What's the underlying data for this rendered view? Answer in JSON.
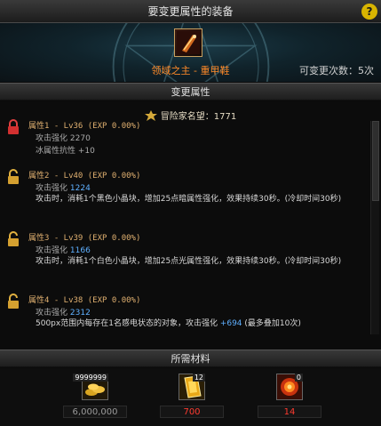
{
  "window": {
    "title": "要变更属性的装备",
    "help_label": "?"
  },
  "equip": {
    "item_name": "领域之主 - 重甲鞋",
    "change_count": "可变更次数：5次",
    "icon": "boots-item-icon"
  },
  "attributes_section": {
    "header": "变更属性",
    "fame_label": "冒险家名望：1771",
    "items": [
      {
        "title": "属性1 - Lv36 (EXP 0.00%)",
        "line1_label": "攻击强化",
        "line1_value": "2270",
        "line2": "冰属性抗性 +10",
        "desc": "",
        "locked": true
      },
      {
        "title": "属性2 - Lv40 (EXP 0.00%)",
        "line1_label": "攻击强化",
        "line1_value": "1224",
        "desc": "攻击时，消耗1个黑色小晶块，增加25点暗属性强化，效果持续30秒。(冷却时间30秒)",
        "locked": false
      },
      {
        "title": "属性3 - Lv39 (EXP 0.00%)",
        "line1_label": "攻击强化",
        "line1_value": "1166",
        "desc": "攻击时，消耗1个白色小晶块，增加25点光属性强化，效果持续30秒。(冷却时间30秒)",
        "locked": false
      },
      {
        "title": "属性4 - Lv38 (EXP 0.00%)",
        "line1_label": "攻击强化",
        "line1_value": "2312",
        "desc_pre": "500px范围内每存在1名感电状态的对象，攻击强化 ",
        "desc_value": "+694",
        "desc_post": " (最多叠加10次)",
        "locked": false
      }
    ]
  },
  "materials_section": {
    "header": "所需材料",
    "items": [
      {
        "icon": "gold-coins-icon",
        "badge": "9999999",
        "count": "6,000,000",
        "count_color": "#9a9a9a"
      },
      {
        "icon": "golden-card-icon",
        "badge": "12",
        "count": "700",
        "count_color": "#ff3b30"
      },
      {
        "icon": "fire-orb-icon",
        "badge": "0",
        "count": "14",
        "count_color": "#ff3b30"
      }
    ]
  }
}
